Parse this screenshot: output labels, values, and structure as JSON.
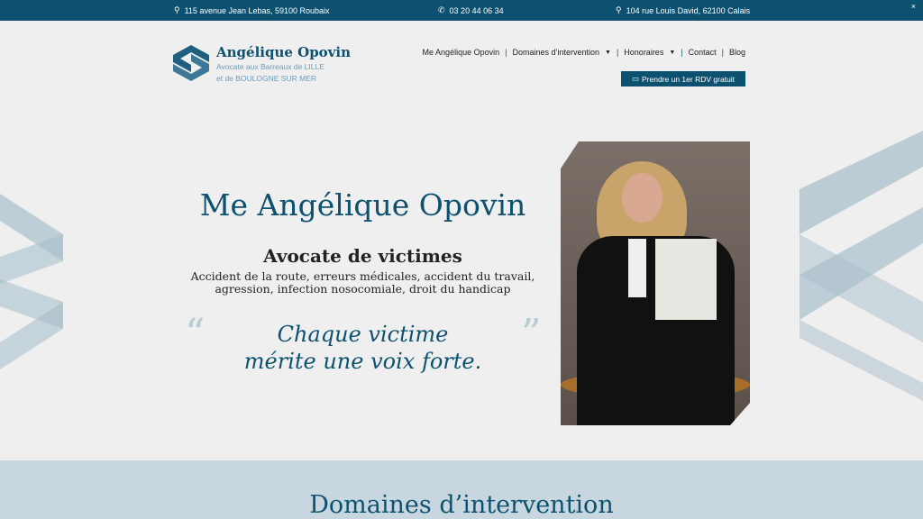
{
  "topbar": {
    "address1": "115 avenue Jean Lebas, 59100 Roubaix",
    "phone": "03 20 44 06 34",
    "address2": "104 rue Louis David, 62100 Calais",
    "close": "×"
  },
  "brand": {
    "name": "Angélique Opovin",
    "line1": "Avocate aux Barreaux de LILLE",
    "line2": "et de BOULOGNE SUR MER"
  },
  "nav": {
    "items": [
      "Me Angélique Opovin",
      "Domaines d’intervention",
      "Honoraires",
      "Contact",
      "Blog"
    ],
    "cta": "Prendre un 1er RDV gratuit"
  },
  "hero": {
    "title": "Me Angélique Opovin",
    "subtitle": "Avocate de victimes",
    "desc1": "Accident de la route, erreurs médicales, accident du travail,",
    "desc2": "agression, infection nosocomiale, droit du handicap",
    "quote1": "Chaque victime",
    "quote2": "mérite une voix forte.",
    "open_quote": "“",
    "close_quote": "”"
  },
  "section": {
    "title": "Domaines d’intervention"
  },
  "colors": {
    "primary": "#0d5170",
    "light": "#c8d7df"
  }
}
